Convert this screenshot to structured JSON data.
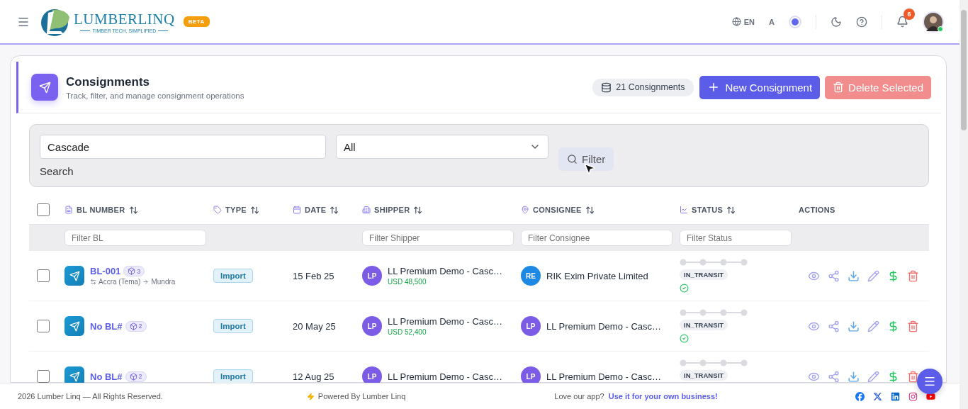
{
  "header": {
    "logo": {
      "name": "LUMBERLINQ",
      "tagline": "TIMBER TECH, SIMPLIFIED"
    },
    "badge": "BETA",
    "language": "EN",
    "font_size": "A",
    "notifications": "6"
  },
  "page": {
    "title": "Consignments",
    "subtitle": "Track, filter, and manage consignment operations",
    "count": "21 Consignments",
    "new_button": "New Consignment",
    "delete_button": {
      "label": "Delete Selected",
      "disabled": true
    }
  },
  "filters": {
    "search": {
      "value": "Cascade",
      "label": "Search"
    },
    "type": {
      "value": "All"
    },
    "button": "Filter"
  },
  "table": {
    "select_all": {
      "checked": false
    },
    "columns": [
      {
        "label": "BL NUMBER",
        "sortable": true,
        "placeholder": "Filter BL"
      },
      {
        "label": "TYPE",
        "sortable": true
      },
      {
        "label": "DATE",
        "sortable": true
      },
      {
        "label": "SHIPPER",
        "sortable": true,
        "placeholder": "Filter Shipper"
      },
      {
        "label": "CONSIGNEE",
        "sortable": true,
        "placeholder": "Filter Consignee"
      },
      {
        "label": "STATUS",
        "sortable": true,
        "placeholder": "Filter Status"
      },
      {
        "label": "ACTIONS",
        "sortable": false
      }
    ],
    "rows": [
      {
        "checked": false,
        "bl": "BL-001",
        "packages": "3",
        "route": {
          "from": "Accra (Tema)",
          "to": "Mundra"
        },
        "type": "Import",
        "date": "15 Feb 25",
        "shipper": {
          "initials": "LP",
          "name": "LL Premium Demo - Casc…",
          "amount": "USD 48,500",
          "color": "#7c5ce6"
        },
        "consignee": {
          "initials": "RE",
          "name": "RIK Exim Private Limited",
          "color": "#1e88e5"
        },
        "status": "IN_TRANSIT",
        "verified": true
      },
      {
        "checked": false,
        "bl": "No BL#",
        "packages": "2",
        "type": "Import",
        "date": "20 May 25",
        "shipper": {
          "initials": "LP",
          "name": "LL Premium Demo - Casc…",
          "amount": "USD 52,400",
          "color": "#7c5ce6"
        },
        "consignee": {
          "initials": "LP",
          "name": "LL Premium Demo - Casc…",
          "color": "#7c5ce6"
        },
        "status": "IN_TRANSIT",
        "verified": true
      },
      {
        "checked": false,
        "bl": "No BL#",
        "packages": "2",
        "type": "Import",
        "date": "12 Aug 25",
        "shipper": {
          "initials": "LP",
          "name": "LL Premium Demo - Casc…",
          "color": "#7c5ce6"
        },
        "consignee": {
          "initials": "LP",
          "name": "LL Premium Demo - Casc…",
          "color": "#7c5ce6"
        },
        "status": "IN_TRANSIT"
      }
    ]
  },
  "footer": {
    "copyright": "2026 Lumber Linq — All Rights Reserved.",
    "powered": "Powered By Lumber Linq",
    "prompt": "Love our app?",
    "link": "Use it for your own business!"
  }
}
